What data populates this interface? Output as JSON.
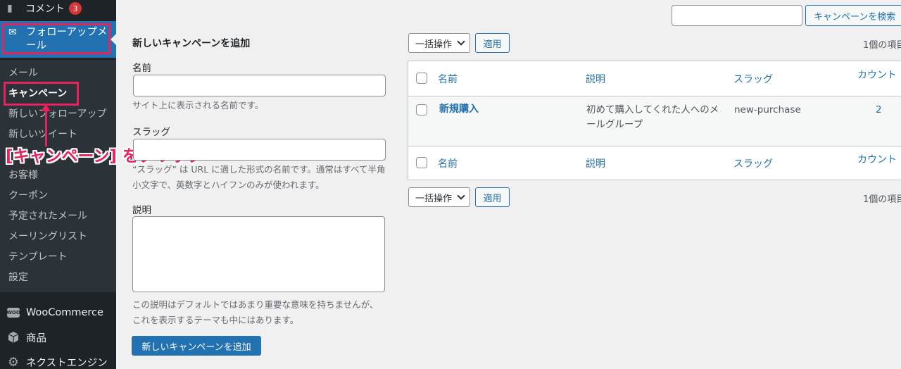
{
  "sidebar": {
    "comments": {
      "label": "コメント",
      "badge": "3",
      "icon": "comment-icon"
    },
    "active_menu": {
      "label": "フォローアップメール",
      "icon": "envelope-icon"
    },
    "submenu": [
      {
        "label": "メール",
        "current": false
      },
      {
        "label": "キャンペーン",
        "current": true
      },
      {
        "label": "新しいフォローアップ",
        "current": false
      },
      {
        "label": "新しいツイート",
        "current": false
      },
      {
        "label": "お客様",
        "current": false
      },
      {
        "label": "クーポン",
        "current": false
      },
      {
        "label": "予定されたメール",
        "current": false
      },
      {
        "label": "メーリングリスト",
        "current": false
      },
      {
        "label": "テンプレート",
        "current": false
      },
      {
        "label": "設定",
        "current": false
      }
    ],
    "lower": [
      {
        "label": "WooCommerce",
        "icon": "woocommerce-icon"
      },
      {
        "label": "商品",
        "icon": "box-icon"
      },
      {
        "label": "ネクストエンジン",
        "icon": "gear-icon"
      }
    ]
  },
  "annotation": {
    "text": "[キャンペーン] をクリック",
    "color": "#e5245e"
  },
  "search": {
    "value": "",
    "button_label": "キャンペーンを検索"
  },
  "form": {
    "title": "新しいキャンペーンを追加",
    "name_label": "名前",
    "name_value": "",
    "name_help": "サイト上に表示される名前です。",
    "slug_label": "スラッグ",
    "slug_value": "",
    "slug_help": "“スラッグ” は URL に適した形式の名前です。通常はすべて半角小文字で、英数字とハイフンのみが使われます。",
    "desc_label": "説明",
    "desc_value": "",
    "desc_help": "この説明はデフォルトではあまり重要な意味を持ちませんが、これを表示するテーマも中にはあります。",
    "submit_label": "新しいキャンペーンを追加"
  },
  "list": {
    "bulk_label": "一括操作",
    "apply_label": "適用",
    "item_count": "1個の項目",
    "columns": [
      "名前",
      "説明",
      "スラッグ",
      "カウント"
    ],
    "rows": [
      {
        "name": "新規購入",
        "description": "初めて購入してくれた人へのメールグループ",
        "slug": "new-purchase",
        "count": "2"
      }
    ]
  },
  "colors": {
    "accent": "#2271b1",
    "highlight": "#e5245e",
    "sidebar_bg": "#1d2327"
  }
}
